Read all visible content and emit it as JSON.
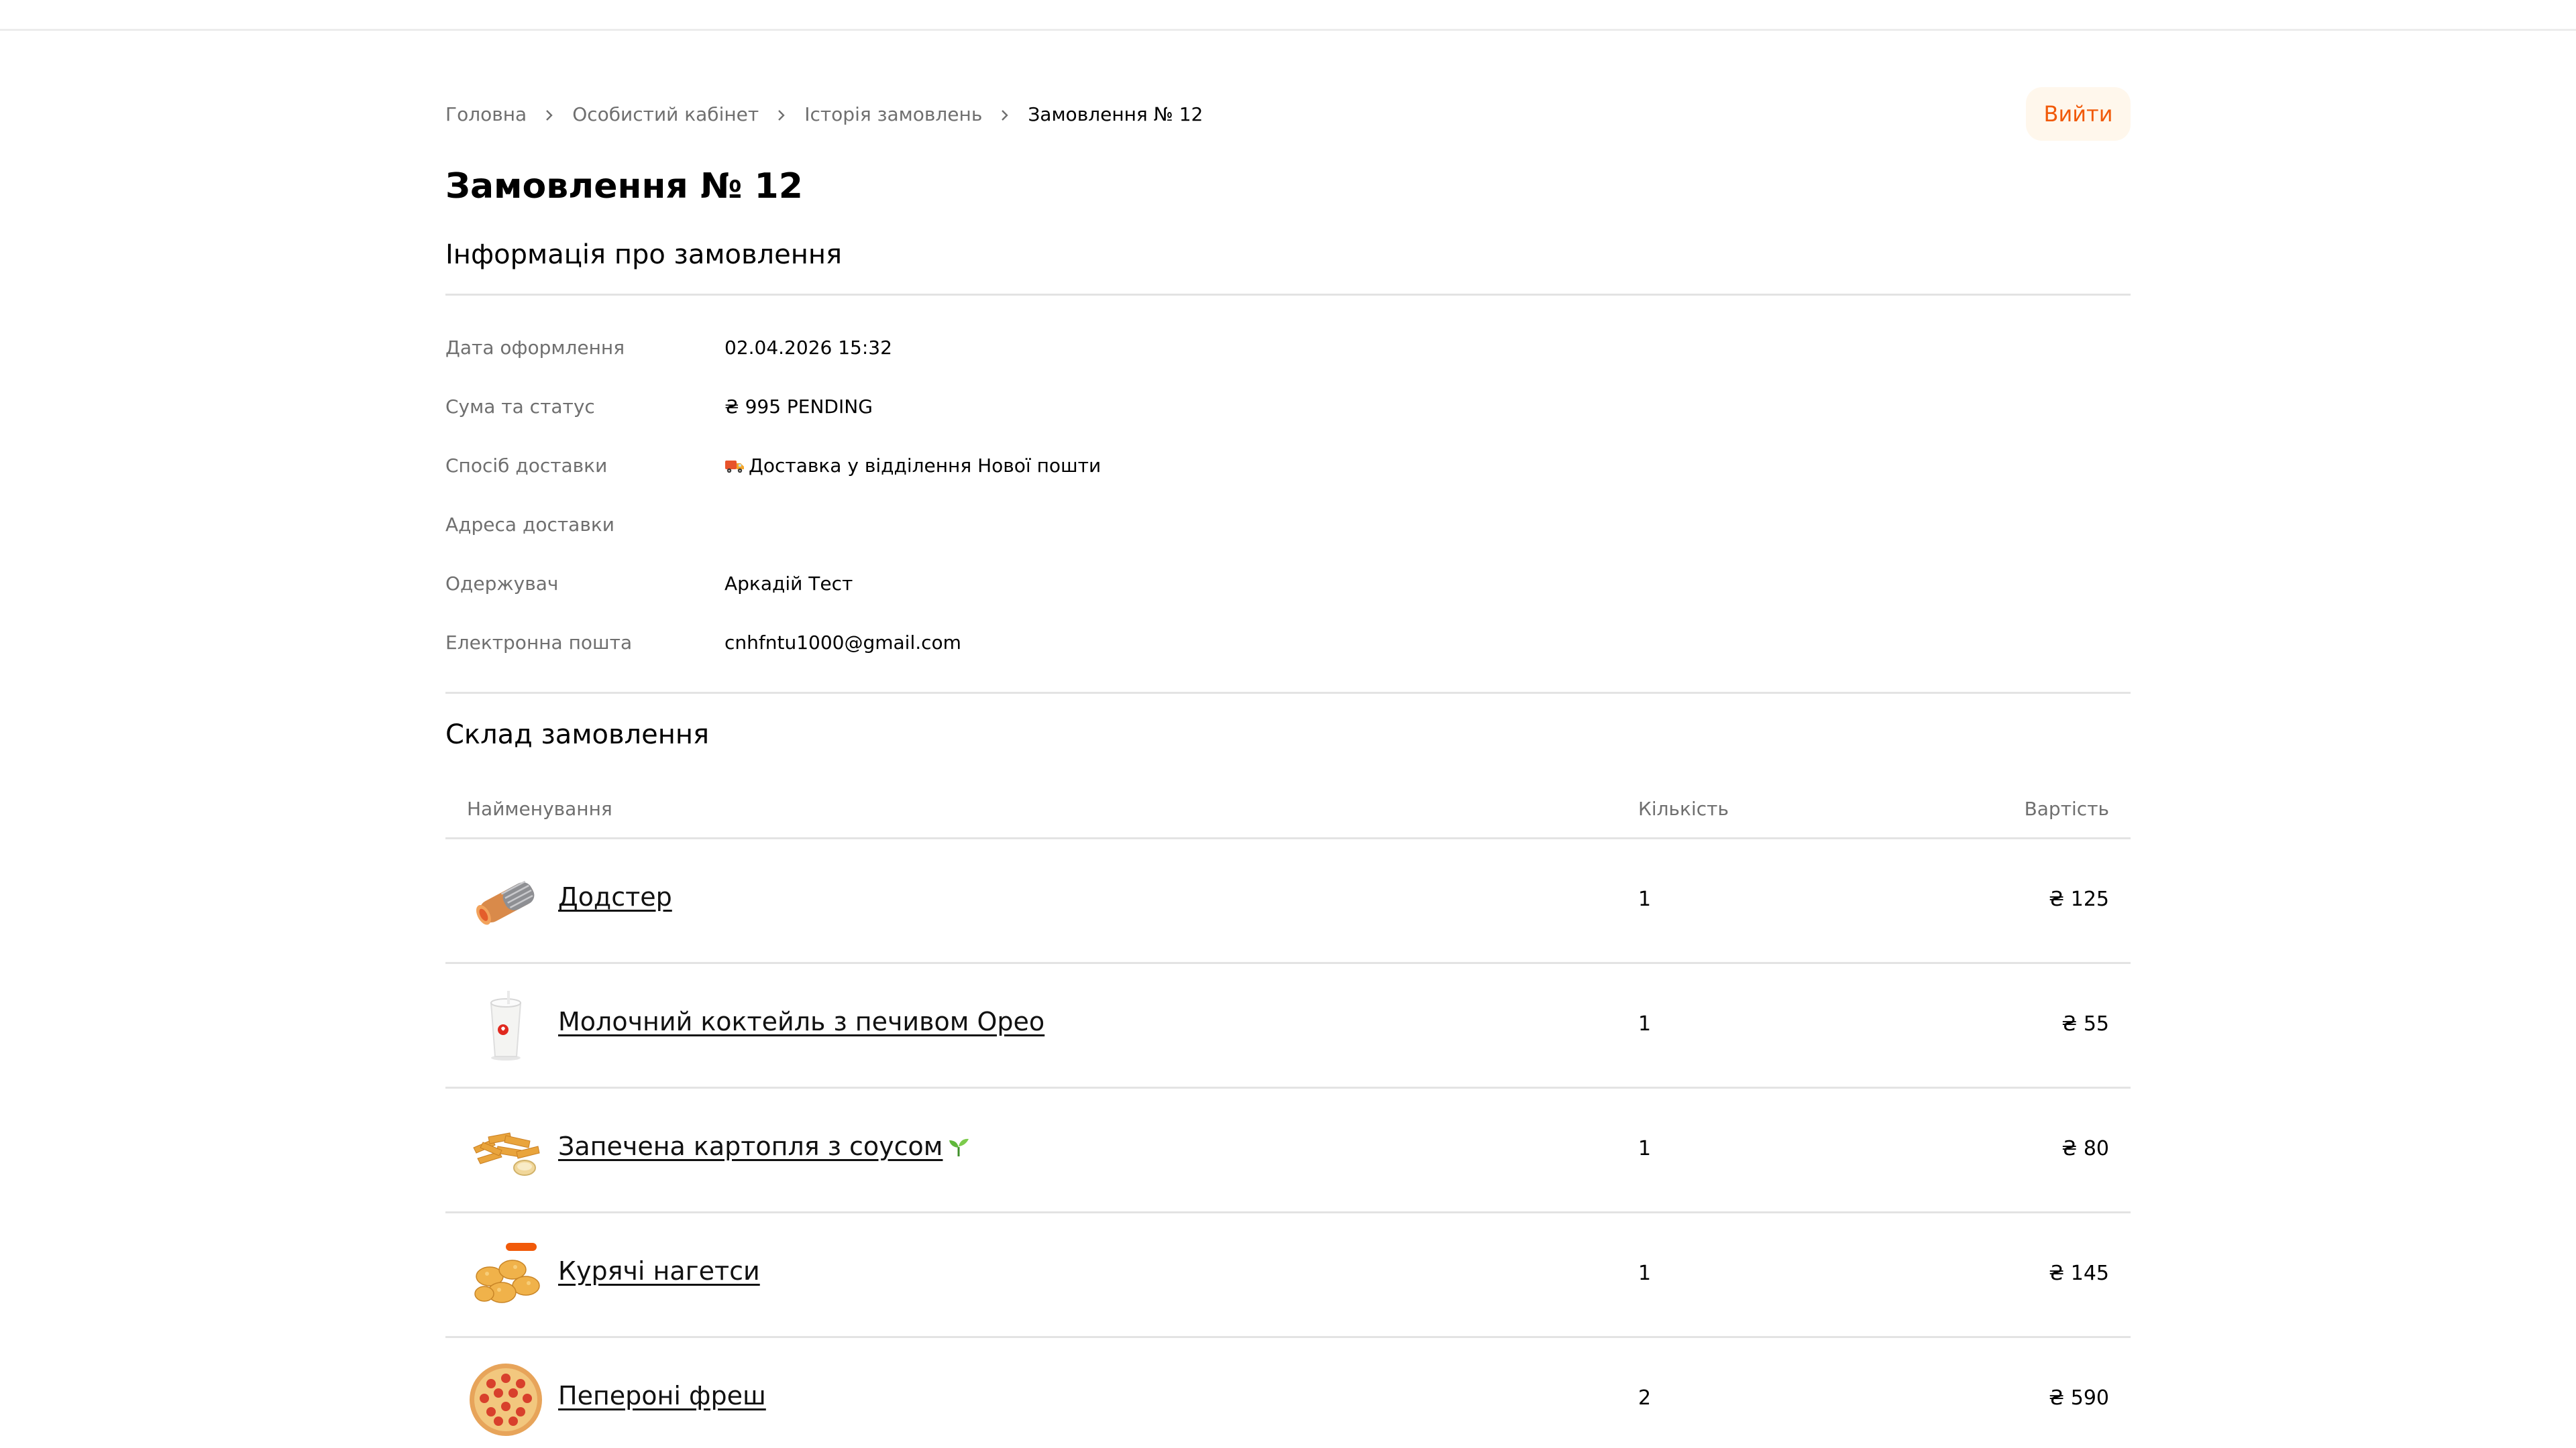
{
  "breadcrumb": {
    "items": [
      "Головна",
      "Особистий кабінет",
      "Історія замовлень"
    ],
    "current": "Замовлення № 12"
  },
  "header": {
    "logout_label": "Вийти"
  },
  "page_title": "Замовлення № 12",
  "order_info": {
    "title": "Інформація про замовлення",
    "rows": [
      {
        "label": "Дата оформлення",
        "value": "02.04.2026 15:32"
      },
      {
        "label": "Сума та статус",
        "value": "₴ 995 PENDING"
      },
      {
        "label": "Спосіб доставки",
        "value": "Доставка у відділення Нової пошти",
        "icon": "truck-icon"
      },
      {
        "label": "Адреса доставки",
        "value": ""
      },
      {
        "label": "Одержувач",
        "value": "Аркадій Тест"
      },
      {
        "label": "Електронна пошта",
        "value": "cnhfntu1000@gmail.com"
      }
    ]
  },
  "order_items": {
    "title": "Склад замовлення",
    "columns": {
      "name": "Найменування",
      "qty": "Кількість",
      "price": "Вартість"
    },
    "rows": [
      {
        "name": "Додстер",
        "qty": "1",
        "price": "₴ 125",
        "thumb": "dodster-image"
      },
      {
        "name": "Молочний коктейль з печивом Орео",
        "qty": "1",
        "price": "₴ 55",
        "thumb": "milkshake-image"
      },
      {
        "name": "Запечена картопля з соусом",
        "qty": "1",
        "price": "₴ 80",
        "thumb": "potato-image",
        "badge_icon": "sprout-icon"
      },
      {
        "name": "Курячі нагетси",
        "qty": "1",
        "price": "₴ 145",
        "thumb": "nuggets-image"
      },
      {
        "name": "Пепероні фреш",
        "qty": "2",
        "price": "₴ 590",
        "thumb": "pizza-image"
      }
    ]
  },
  "colors": {
    "accent": "#f15a0a",
    "accent_bg": "#fff7ec",
    "muted_text": "#6f6f6f",
    "divider": "#e3e3e3"
  }
}
